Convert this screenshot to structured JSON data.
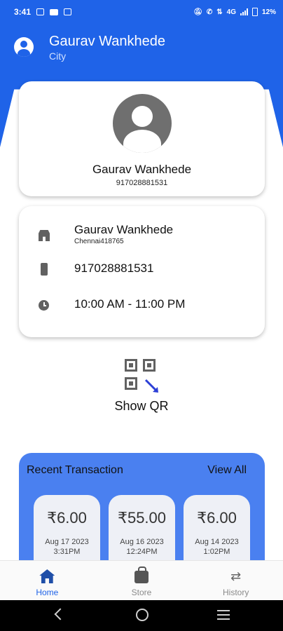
{
  "status_bar": {
    "time": "3:41",
    "network": "4G",
    "battery": "12%",
    "icons": [
      "sim-icon",
      "mail-icon",
      "sim-icon",
      "mute-icon",
      "wifi-calling-icon",
      "data-icon",
      "signal-icon",
      "battery-icon"
    ]
  },
  "header": {
    "name": "Gaurav Wankhede",
    "subtitle": "City"
  },
  "profile": {
    "name": "Gaurav Wankhede",
    "phone": "917028881531"
  },
  "info": {
    "store_name": "Gaurav Wankhede",
    "store_address": "Chennai418765",
    "phone": "917028881531",
    "hours": "10:00 AM - 11:00 PM"
  },
  "qr": {
    "label": "Show QR"
  },
  "transactions": {
    "title": "Recent Transaction",
    "view_all": "View All",
    "items": [
      {
        "amount": "₹6.00",
        "date": "Aug 17 2023",
        "time": "3:31PM"
      },
      {
        "amount": "₹55.00",
        "date": "Aug 16 2023",
        "time": "12:24PM"
      },
      {
        "amount": "₹6.00",
        "date": "Aug 14 2023",
        "time": "1:02PM"
      }
    ]
  },
  "nav": {
    "home": "Home",
    "store": "Store",
    "history": "History"
  },
  "colors": {
    "primary": "#1f63e8",
    "panel": "#4a80f0",
    "card": "#eef0f6",
    "icon": "#616161"
  }
}
